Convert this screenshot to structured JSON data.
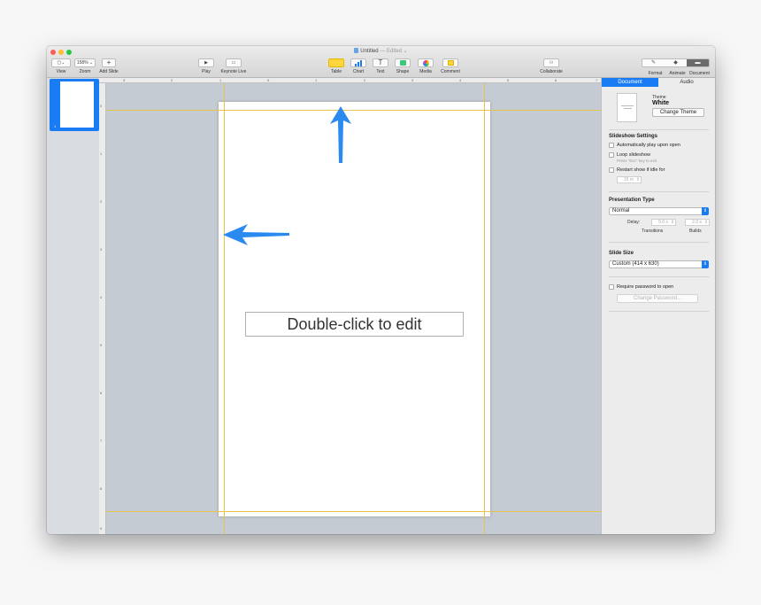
{
  "window": {
    "title": "Untitled",
    "edited": "— Edited ⌄"
  },
  "toolbar": {
    "view": {
      "label": "View",
      "glyph": "▢⌄"
    },
    "zoom": {
      "label": "Zoom",
      "value": "158% ⌄"
    },
    "add_slide": {
      "label": "Add Slide",
      "glyph": "+"
    },
    "play": {
      "label": "Play",
      "glyph": "▶"
    },
    "keynote_live": {
      "label": "Keynote Live",
      "glyph": "▭"
    },
    "table": {
      "label": "Table"
    },
    "chart": {
      "label": "Chart"
    },
    "text": {
      "label": "Text",
      "glyph": "T"
    },
    "shape": {
      "label": "Shape"
    },
    "media": {
      "label": "Media"
    },
    "comment": {
      "label": "Comment"
    },
    "collaborate": {
      "label": "Collaborate",
      "glyph": "⚇"
    },
    "format": {
      "label": "Format",
      "glyph": "✎"
    },
    "animate": {
      "label": "Animate",
      "glyph": "◆"
    },
    "document": {
      "label": "Document",
      "glyph": "▬"
    }
  },
  "navigator": {
    "slides": [
      {
        "number": "1"
      }
    ]
  },
  "rulers": {
    "top": [
      "3",
      "2",
      "1",
      "0",
      "1",
      "2",
      "3",
      "4",
      "5",
      "6",
      "7",
      "8"
    ],
    "left": [
      "0",
      "1",
      "2",
      "3",
      "4",
      "5",
      "6",
      "7",
      "8",
      "9"
    ]
  },
  "slide": {
    "placeholder": "Double-click to edit"
  },
  "inspector": {
    "tabs": {
      "document": "Document",
      "audio": "Audio"
    },
    "theme": {
      "label": "Theme",
      "name": "White",
      "change_button": "Change Theme"
    },
    "slideshow": {
      "title": "Slideshow Settings",
      "autoplay": "Automatically play upon open",
      "loop": "Loop slideshow",
      "loop_hint": "Press \"Esc\" key to exit",
      "restart": "Restart show if idle for",
      "restart_value": "15 m"
    },
    "presentation": {
      "title": "Presentation Type",
      "type_value": "Normal",
      "delay_label": "Delay:",
      "transitions_value": "5.0 s",
      "builds_value": "2.0 s",
      "transitions_label": "Transitions",
      "builds_label": "Builds"
    },
    "slide_size": {
      "title": "Slide Size",
      "value": "Custom (414 x 630)"
    },
    "password": {
      "require": "Require password to open",
      "change_button": "Change Password..."
    }
  },
  "colors": {
    "accent": "#1a7cf5",
    "guide": "#e6c34d",
    "canvas": "#c5cbd3"
  }
}
